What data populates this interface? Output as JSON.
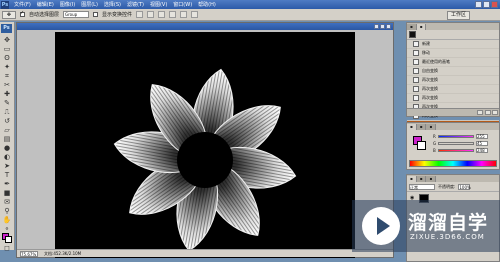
{
  "menubar": {
    "logo": "Ps",
    "items": [
      "文件(F)",
      "编辑(E)",
      "图像(I)",
      "图层(L)",
      "选择(S)",
      "滤镜(T)",
      "视图(V)",
      "窗口(W)",
      "帮助(H)"
    ]
  },
  "options": {
    "auto_select_label": "自动选择图层",
    "auto_select_value": "Group",
    "show_transform_label": "显示变换控件",
    "workspace_label": "工作区"
  },
  "document": {
    "zoom": "75.67%",
    "doc_info": "文档:452.3K/2.10M"
  },
  "history": {
    "items": [
      "新建",
      "移动",
      "最近使用的画笔",
      "自由变换",
      "再次变换",
      "再次变换",
      "再次变换",
      "再次变换",
      "再次变换",
      "再次变换"
    ],
    "selected_index": 9
  },
  "color": {
    "foreground": "#cc22cc",
    "background": "#ffffff",
    "r_value": "255",
    "g_value": "45",
    "b_value": "248"
  },
  "layers": {
    "mode": "正常",
    "opacity_label": "不透明度:",
    "opacity_value": "100%"
  },
  "watermark": {
    "title": "溜溜自学",
    "url": "ZIXUE.3D66.COM"
  }
}
